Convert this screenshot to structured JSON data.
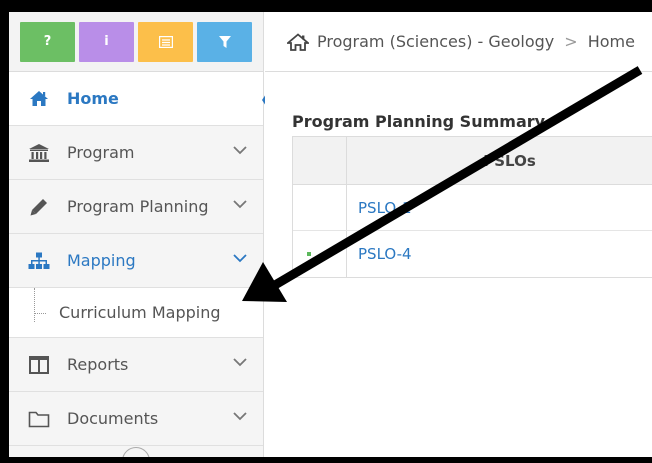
{
  "toolbar": {
    "buttons": [
      {
        "name": "help",
        "glyph": "?",
        "color": "#6cbf64"
      },
      {
        "name": "info",
        "glyph": "i",
        "color": "#b98ee8"
      },
      {
        "name": "list",
        "glyph": "",
        "color": "#fcbf4a"
      },
      {
        "name": "filter",
        "glyph": "",
        "color": "#5ab1e6"
      }
    ]
  },
  "sidebar": {
    "home": "Home",
    "items": [
      {
        "label": "Program",
        "icon": "institution-icon"
      },
      {
        "label": "Program Planning",
        "icon": "pencil-icon"
      },
      {
        "label": "Mapping",
        "icon": "sitemap-icon"
      },
      {
        "label": "Reports",
        "icon": "columns-icon"
      },
      {
        "label": "Documents",
        "icon": "folder-icon"
      }
    ],
    "subitem": "Curriculum Mapping"
  },
  "breadcrumb": {
    "program": "Program (Sciences) - Geology",
    "separator": ">",
    "current": "Home"
  },
  "summary": {
    "title": "Program Planning Summary",
    "column_header": "PSLOs",
    "rows": [
      "PSLO-1",
      "PSLO-4"
    ]
  },
  "colors": {
    "accent": "#2b78c2",
    "sidebar_bg": "#f5f5f5"
  }
}
